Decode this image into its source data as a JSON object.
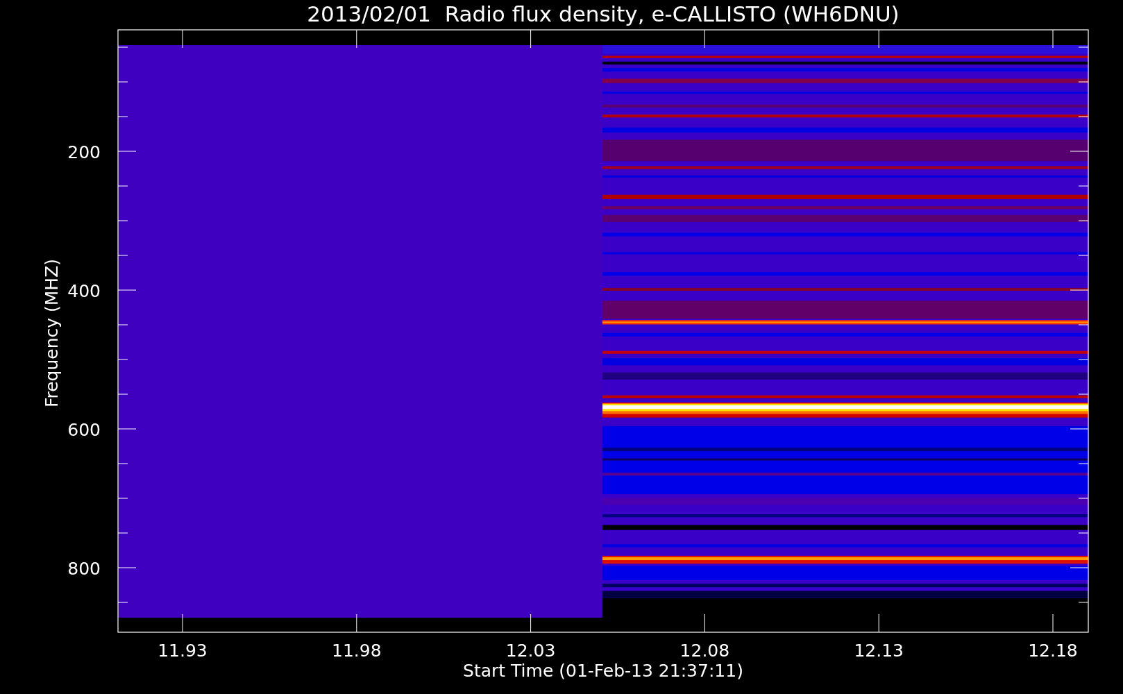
{
  "title": "2013/02/01  Radio flux density, e-CALLISTO (WH6DNU)",
  "y_axis": {
    "label": "Frequency (MHZ)",
    "ticks": [
      "200",
      "400",
      "600",
      "800"
    ]
  },
  "x_axis": {
    "label": "Start Time (01-Feb-13 21:37:11)",
    "ticks": [
      "11.93",
      "11.98",
      "12.03",
      "12.08",
      "12.13",
      "12.18"
    ]
  }
}
